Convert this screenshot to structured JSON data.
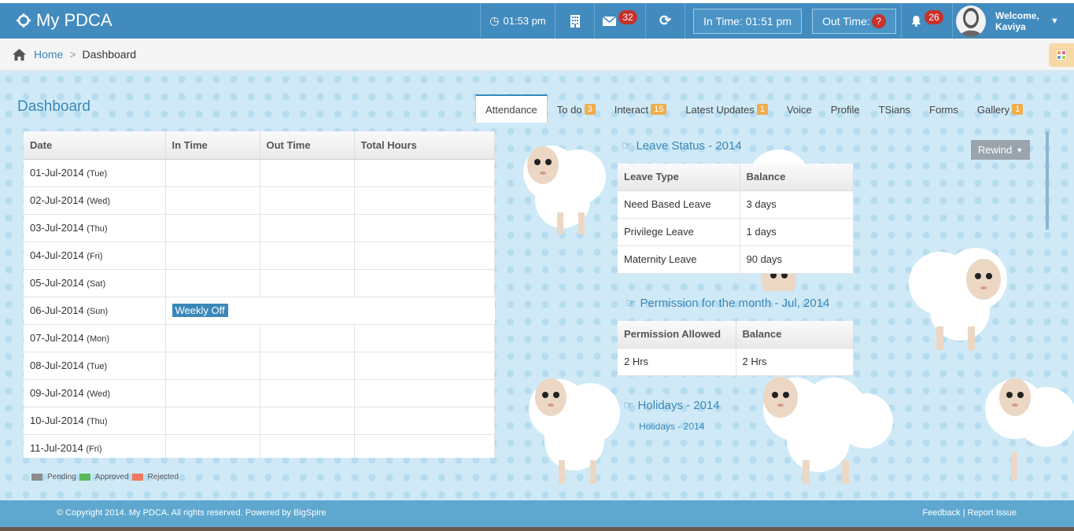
{
  "app": {
    "title": "My PDCA"
  },
  "topbar": {
    "clock": "01:53 pm",
    "mail_count": "32",
    "in_time": "In Time: 01:51 pm",
    "out_time": "Out Time:",
    "out_time_badge": "?",
    "notif_count": "26",
    "welcome": "Welcome,",
    "user": "Kaviya"
  },
  "breadcrumb": {
    "home": "Home",
    "sep": ">",
    "current": "Dashboard"
  },
  "page_title": "Dashboard",
  "tabs": [
    {
      "label": "Attendance",
      "badge": ""
    },
    {
      "label": "To do",
      "badge": "3"
    },
    {
      "label": "Interact",
      "badge": "15"
    },
    {
      "label": "Latest Updates",
      "badge": "1"
    },
    {
      "label": "Voice",
      "badge": ""
    },
    {
      "label": "Profile",
      "badge": ""
    },
    {
      "label": "TSians",
      "badge": ""
    },
    {
      "label": "Forms",
      "badge": ""
    },
    {
      "label": "Gallery",
      "badge": "1"
    }
  ],
  "attendance": {
    "headers": [
      "Date",
      "In Time",
      "Out Time",
      "Total Hours"
    ],
    "rows": [
      {
        "date": "01-Jul-2014",
        "day": "(Tue)"
      },
      {
        "date": "02-Jul-2014",
        "day": "(Wed)"
      },
      {
        "date": "03-Jul-2014",
        "day": "(Thu)"
      },
      {
        "date": "04-Jul-2014",
        "day": "(Fri)"
      },
      {
        "date": "05-Jul-2014",
        "day": "(Sat)"
      },
      {
        "date": "06-Jul-2014",
        "day": "(Sun)",
        "note": "Weekly Off"
      },
      {
        "date": "07-Jul-2014",
        "day": "(Mon)"
      },
      {
        "date": "08-Jul-2014",
        "day": "(Tue)"
      },
      {
        "date": "09-Jul-2014",
        "day": "(Wed)"
      },
      {
        "date": "10-Jul-2014",
        "day": "(Thu)"
      },
      {
        "date": "11-Jul-2014",
        "day": "(Fri)"
      }
    ]
  },
  "legend": {
    "pending": "Pending",
    "approved": "Approved",
    "rejected": "Rejected",
    "colors": {
      "pending": "#8c8c8c",
      "approved": "#5cb85c",
      "rejected": "#f07a5f"
    }
  },
  "leave": {
    "title": "Leave Status - 2014",
    "headers": [
      "Leave Type",
      "Balance"
    ],
    "rows": [
      {
        "type": "Need Based Leave",
        "balance": "3 days"
      },
      {
        "type": "Privilege Leave",
        "balance": "1 days"
      },
      {
        "type": "Maternity Leave",
        "balance": "90 days"
      }
    ]
  },
  "permission": {
    "title": "Permission for the month - Jul, 2014",
    "headers": [
      "Permission Allowed",
      "Balance"
    ],
    "rows": [
      {
        "allowed": "2 Hrs",
        "balance": "2 Hrs"
      }
    ]
  },
  "holidays": {
    "title": "Holidays - 2014",
    "link": "Holidays - 2014"
  },
  "rewind": {
    "label": "Rewind"
  },
  "footer": {
    "copyright": "© Copyright 2014. My PDCA. All rights reserved. Powered by BigSpire",
    "feedback": "Feedback",
    "divider": "|",
    "report": "Report Issue"
  },
  "colors": {
    "topbar": "#428bbf",
    "accent": "#3a87b8",
    "badge": "#c9302c",
    "tab_badge": "#f0ad4e"
  }
}
